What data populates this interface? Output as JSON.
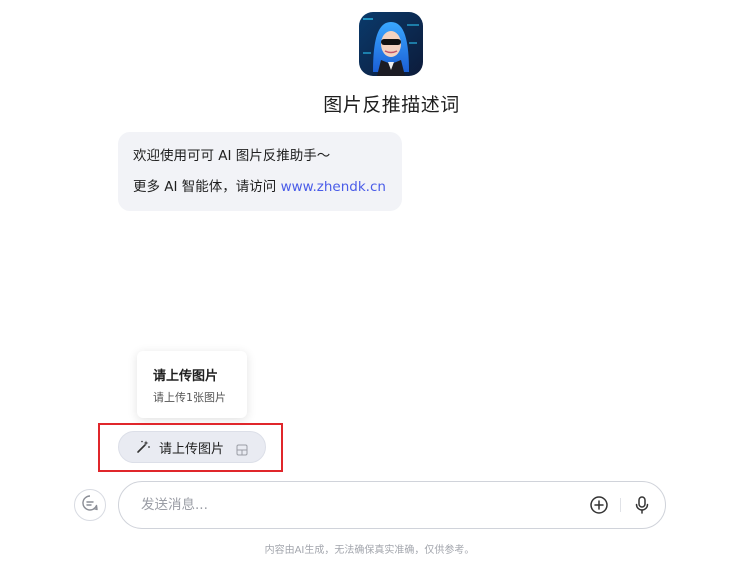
{
  "agent": {
    "avatar_icon": "avatar-image",
    "title": "图片反推描述词"
  },
  "welcome": {
    "line1": "欢迎使用可可 AI 图片反推助手～",
    "line2_prefix": "更多 AI 智能体，请访问 ",
    "line2_link": "www.zhendk.cn"
  },
  "tooltip": {
    "title": "请上传图片",
    "subtitle": "请上传1张图片"
  },
  "chip": {
    "icon": "magic-wand-icon",
    "label": "请上传图片",
    "badge_icon": "image-upload-icon"
  },
  "composer": {
    "placeholder": "发送消息...",
    "left_icon": "new-chat-icon",
    "plus_icon": "plus-circle-icon",
    "mic_icon": "microphone-icon"
  },
  "disclaimer": "内容由AI生成，无法确保真实准确，仅供参考。",
  "colors": {
    "link": "#4a5ce8",
    "highlight": "#e0262b",
    "bubble_bg": "#f2f3f7"
  }
}
